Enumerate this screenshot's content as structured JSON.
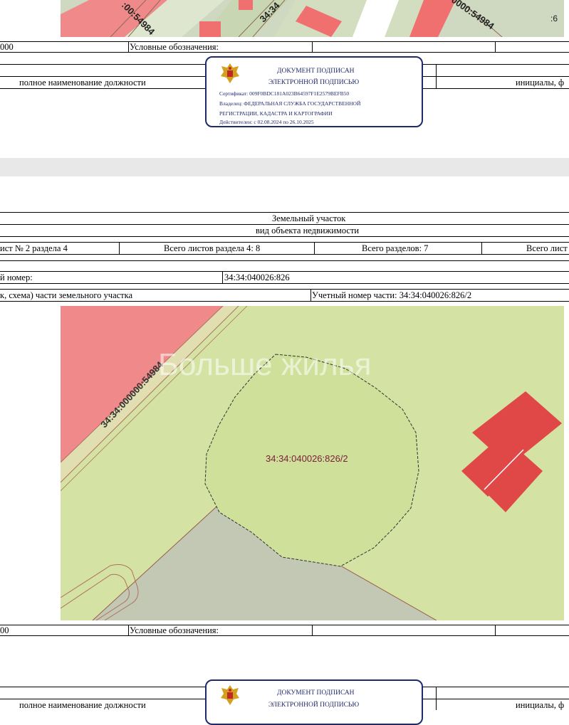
{
  "page1": {
    "map_labels": [
      ":00:54984",
      "34:34",
      "0000:54984"
    ],
    "page_number_fragment": ":6",
    "scale_fragment": "000",
    "legend_label": "Условные обозначения:",
    "position_label": "полное наименование должности",
    "initials_label": "инициалы, ф"
  },
  "stamp": {
    "title": "ДОКУМЕНТ ПОДПИСАН",
    "subtitle": "ЭЛЕКТРОННОЙ ПОДПИСЬЮ",
    "certificate": "Сертификат: 009F0BDC181A023B64597F1E2579BEFB50",
    "owner_line1": "Владелец: ФЕДЕРАЛЬНАЯ СЛУЖБА ГОСУДАРСТВЕННОЙ",
    "owner_line2": "РЕГИСТРАЦИИ, КАДАСТРА И КАРТОГРАФИИ",
    "validity": "Действителен: с 02.08.2024 по 26.10.2025"
  },
  "page2": {
    "object_title": "Земельный участок",
    "object_subtitle": "вид объекта недвижимости",
    "sheet_info": "ист № 2 раздела 4",
    "sheets_in_section": "Всего листов раздела 4: 8",
    "sections_total": "Всего разделов: 7",
    "sheets_total_fragment": "Всего лист",
    "cadastral_label": "й номер:",
    "cadastral_value": "34:34:040026:826",
    "plan_label": "к, схема) части земельного участка",
    "part_number_label": "Учетный номер части: 34:34:040026:826/2",
    "map": {
      "road_label": "34:34:000000:54984",
      "parcel_label": "34:34:040026:826/2",
      "watermark": "Больше жилья"
    },
    "scale_fragment": "00",
    "legend_label": "Условные обозначения:",
    "position_label": "полное наименование должности",
    "initials_label": "инициалы, ф"
  },
  "colors": {
    "map_green": "#d6e4a4",
    "map_light_green": "#cfe19b",
    "red_zone": "#f08a8a",
    "building_red": "#e04848",
    "gray_zone": "#c2c8b4",
    "stamp_blue": "#1f2a6b"
  }
}
